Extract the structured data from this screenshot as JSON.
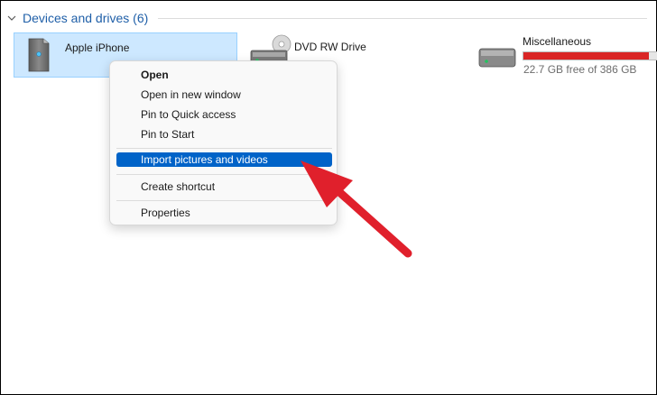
{
  "section": {
    "title": "Devices and drives (6)"
  },
  "devices": [
    {
      "name": "Apple iPhone",
      "icon": "phone-storage-icon"
    },
    {
      "name": "DVD RW Drive",
      "icon": "dvd-drive-icon"
    },
    {
      "name": "Miscellaneous",
      "icon": "hard-drive-icon",
      "free_text": "22.7 GB free of 386 GB",
      "used_fraction": 0.941
    }
  ],
  "context_menu": {
    "items": [
      {
        "label": "Open"
      },
      {
        "label": "Open in new window"
      },
      {
        "label": "Pin to Quick access"
      },
      {
        "label": "Pin to Start"
      },
      {
        "label": "Import pictures and videos"
      },
      {
        "label": "Create shortcut"
      },
      {
        "label": "Properties"
      }
    ]
  },
  "annotation": {
    "icon": "red-arrow-icon",
    "color": "#e0202c"
  },
  "colors": {
    "accent": "#0063c8",
    "selection": "#cde8ff",
    "space_bar_full": "#da2626",
    "header_text": "#1f5fa8"
  }
}
